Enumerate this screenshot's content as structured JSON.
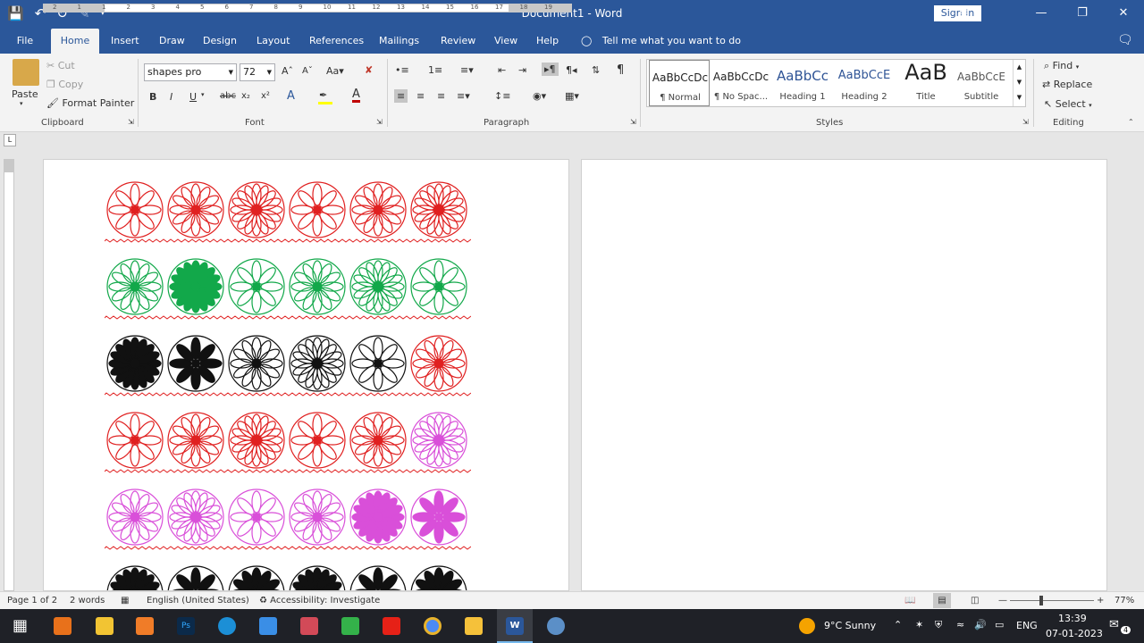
{
  "title_bar": {
    "document": "Document1",
    "separator": "-",
    "app": "Word",
    "sign_in": "Sign in"
  },
  "tabs": [
    "File",
    "Home",
    "Insert",
    "Draw",
    "Design",
    "Layout",
    "References",
    "Mailings",
    "Review",
    "View",
    "Help"
  ],
  "tell_me": "Tell me what you want to do",
  "clipboard": {
    "paste": "Paste",
    "cut": "Cut",
    "copy": "Copy",
    "format_painter": "Format Painter",
    "label": "Clipboard"
  },
  "font": {
    "name": "shapes pro",
    "size": "72",
    "label": "Font"
  },
  "paragraph": {
    "label": "Paragraph"
  },
  "styles": {
    "label": "Styles",
    "items": [
      {
        "preview": "AaBbCcDc",
        "name": "¶ Normal"
      },
      {
        "preview": "AaBbCcDc",
        "name": "¶ No Spac..."
      },
      {
        "preview": "AaBbCc",
        "name": "Heading 1"
      },
      {
        "preview": "AaBbCcE",
        "name": "Heading 2"
      },
      {
        "preview": "AaB",
        "name": "Title"
      },
      {
        "preview": "AaBbCcE",
        "name": "Subtitle"
      }
    ]
  },
  "editing": {
    "find": "Find",
    "replace": "Replace",
    "select": "Select",
    "label": "Editing"
  },
  "ruler_numbers": [
    "2",
    "1",
    "1",
    "2",
    "3",
    "4",
    "5",
    "6",
    "7",
    "8",
    "9",
    "10",
    "11",
    "12",
    "13",
    "14",
    "15",
    "16",
    "17",
    "18",
    "19"
  ],
  "shape_colors": [
    "#e02020",
    "#12a84a",
    "#111111",
    "#e02020",
    "#d94fd9",
    "#111111"
  ],
  "status": {
    "page": "Page 1 of 2",
    "words": "2 words",
    "language": "English (United States)",
    "accessibility": "Accessibility: Investigate",
    "zoom": "77%"
  },
  "taskbar": {
    "weather": "9°C  Sunny",
    "lang": "ENG",
    "time": "13:39",
    "date": "07-01-2023",
    "notif": "4"
  },
  "colors": {
    "word_blue": "#2b579a",
    "ribbon_bg": "#f3f3f3",
    "taskbar_bg": "#1f2127"
  }
}
